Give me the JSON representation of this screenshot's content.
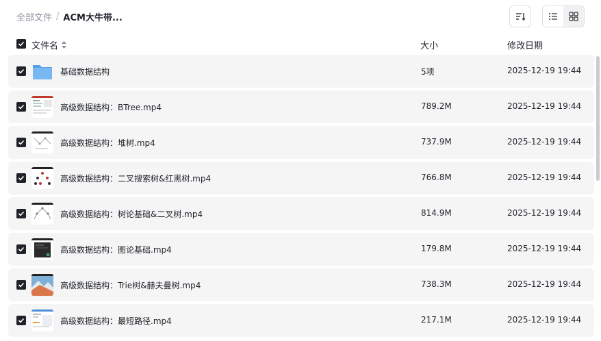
{
  "breadcrumb": {
    "root": "全部文件",
    "separator": "/",
    "current": "ACM大牛带..."
  },
  "header": {
    "name": "文件名",
    "size": "大小",
    "date": "修改日期"
  },
  "rows": [
    {
      "name": "基础数据结构",
      "size": "5项",
      "date": "2025-12-19 19:44",
      "kind": "folder"
    },
    {
      "name": "高级数据结构：BTree.mp4",
      "size": "789.2M",
      "date": "2025-12-19 19:44",
      "kind": "video"
    },
    {
      "name": "高级数据结构：堆树.mp4",
      "size": "737.9M",
      "date": "2025-12-19 19:44",
      "kind": "video"
    },
    {
      "name": "高级数据结构：二叉搜索树&红黑树.mp4",
      "size": "766.8M",
      "date": "2025-12-19 19:44",
      "kind": "video"
    },
    {
      "name": "高级数据结构：树论基础&二叉树.mp4",
      "size": "814.9M",
      "date": "2025-12-19 19:44",
      "kind": "video"
    },
    {
      "name": "高级数据结构：图论基础.mp4",
      "size": "179.8M",
      "date": "2025-12-19 19:44",
      "kind": "video"
    },
    {
      "name": "高级数据结构：Trie树&赫夫曼树.mp4",
      "size": "738.3M",
      "date": "2025-12-19 19:44",
      "kind": "video"
    },
    {
      "name": "高级数据结构：最短路径.mp4",
      "size": "217.1M",
      "date": "2025-12-19 19:44",
      "kind": "video"
    }
  ],
  "colors": {
    "folder": "#6fb1f0",
    "checkbox": "#1f2329",
    "row_bg": "#f5f5f6"
  }
}
